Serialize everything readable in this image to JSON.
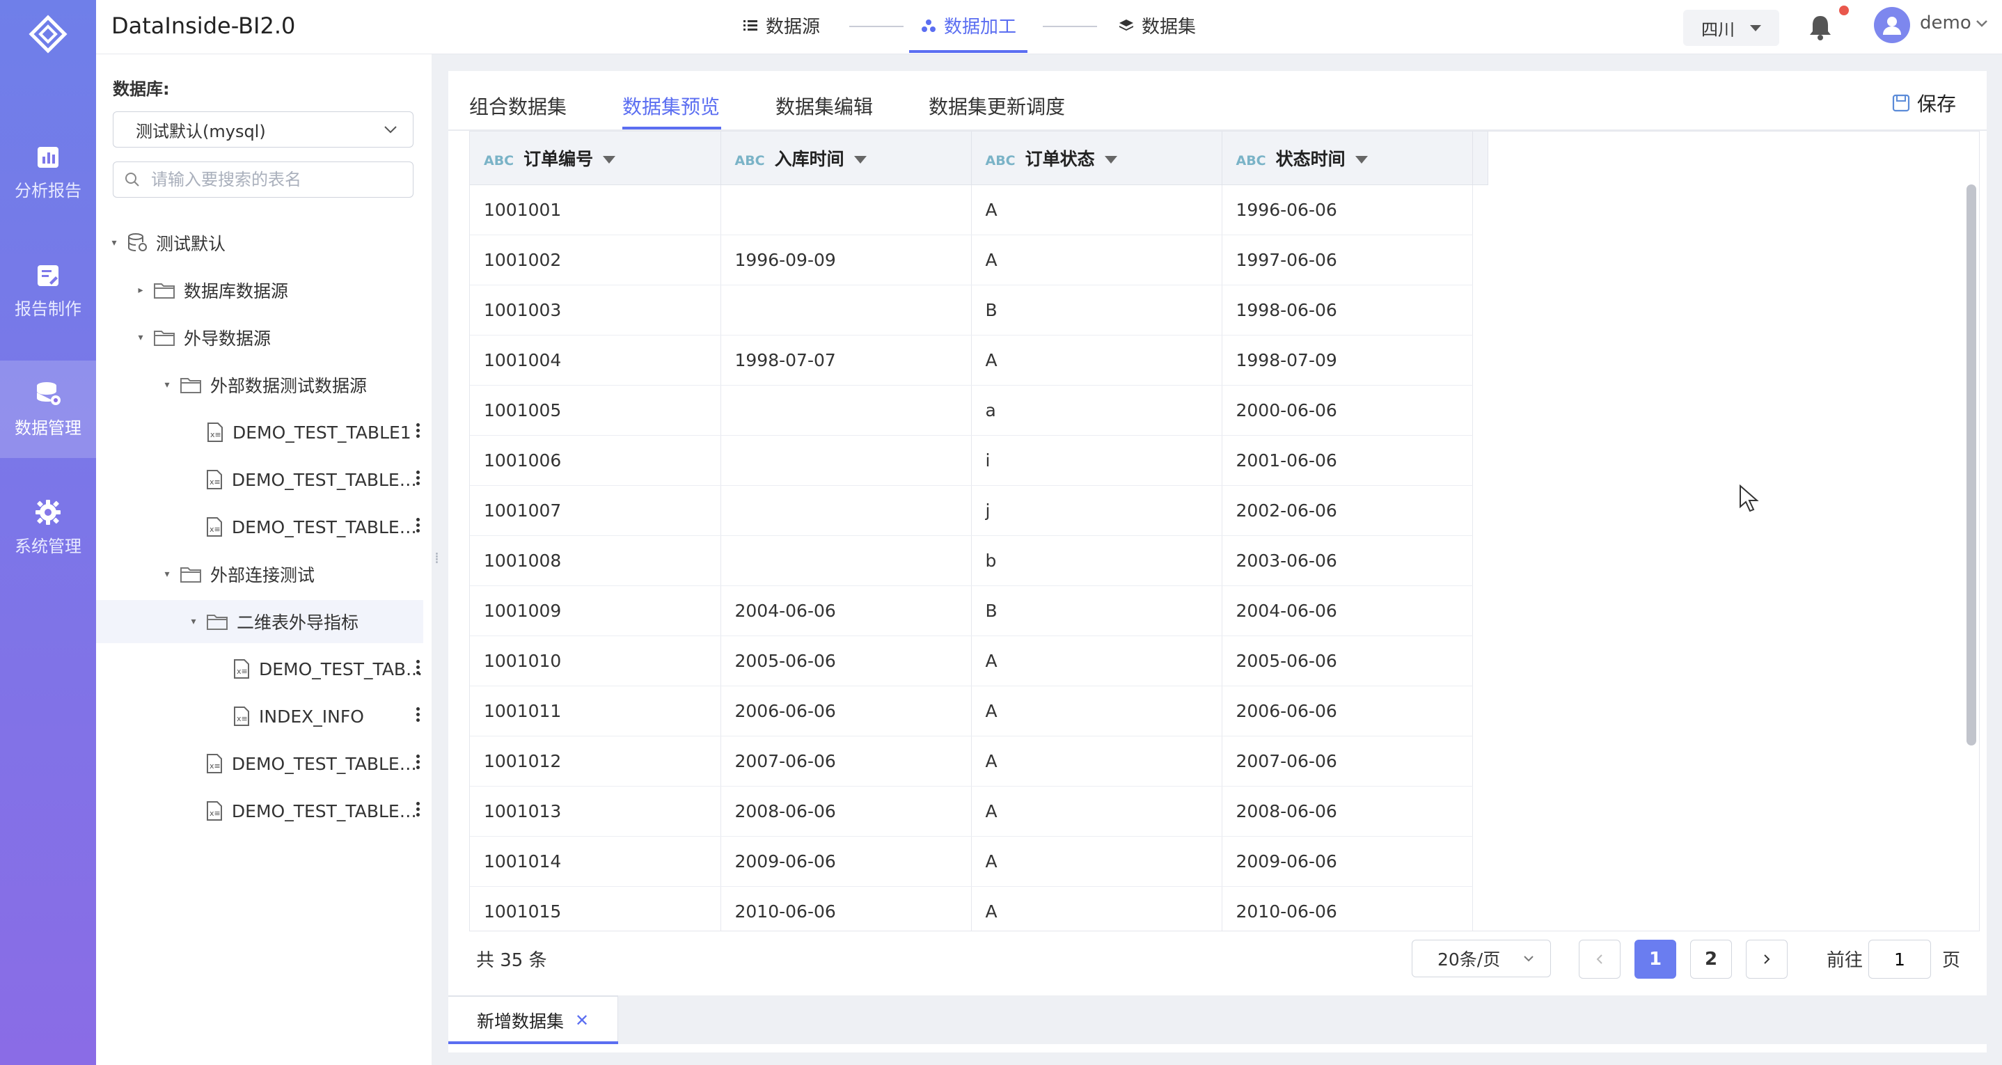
{
  "app": {
    "title": "DataInside-BI2.0"
  },
  "rail": {
    "items": [
      {
        "label": "分析报告",
        "icon": "report-chart-icon"
      },
      {
        "label": "报告制作",
        "icon": "edit-doc-icon"
      },
      {
        "label": "数据管理",
        "icon": "database-icon",
        "active": true
      },
      {
        "label": "系统管理",
        "icon": "gear-icon"
      }
    ]
  },
  "steps": [
    {
      "label": "数据源",
      "icon": "list-icon"
    },
    {
      "label": "数据加工",
      "icon": "cluster-icon",
      "active": true
    },
    {
      "label": "数据集",
      "icon": "layers-icon"
    }
  ],
  "header": {
    "region": "四川",
    "user": "demo"
  },
  "sidebar": {
    "db_label": "数据库:",
    "db_select": "测试默认(mysql)",
    "search_placeholder": "请输入要搜索的表名",
    "tree": [
      {
        "label": "测试默认",
        "type": "db",
        "level": 0,
        "expanded": true
      },
      {
        "label": "数据库数据源",
        "type": "folder",
        "level": 1,
        "expanded": false
      },
      {
        "label": "外导数据源",
        "type": "folder",
        "level": 1,
        "expanded": true
      },
      {
        "label": "外部数据测试数据源",
        "type": "folder",
        "level": 2,
        "expanded": true
      },
      {
        "label": "DEMO_TEST_TABLE1",
        "type": "table",
        "level": 3
      },
      {
        "label": "DEMO_TEST_TABLE_...",
        "type": "table",
        "level": 3
      },
      {
        "label": "DEMO_TEST_TABLE_...",
        "type": "table",
        "level": 3
      },
      {
        "label": "外部连接测试",
        "type": "folder",
        "level": 2,
        "expanded": true
      },
      {
        "label": "二维表外导指标",
        "type": "folder",
        "level": 3,
        "expanded": true,
        "active": true
      },
      {
        "label": "DEMO_TEST_TAB...",
        "type": "table",
        "level": 4
      },
      {
        "label": "INDEX_INFO",
        "type": "table",
        "level": 4
      },
      {
        "label": "DEMO_TEST_TABLE_...",
        "type": "table",
        "level": 3
      },
      {
        "label": "DEMO_TEST_TABLE_...",
        "type": "table",
        "level": 3
      }
    ]
  },
  "tabs": [
    {
      "label": "组合数据集"
    },
    {
      "label": "数据集预览",
      "active": true
    },
    {
      "label": "数据集编辑"
    },
    {
      "label": "数据集更新调度"
    }
  ],
  "save_label": "保存",
  "table": {
    "type_tag": "ABC",
    "columns": [
      "订单编号",
      "入库时间",
      "订单状态",
      "状态时间"
    ],
    "rows": [
      [
        "1001001",
        "",
        "A",
        "1996-06-06"
      ],
      [
        "1001002",
        "1996-09-09",
        "A",
        "1997-06-06"
      ],
      [
        "1001003",
        "",
        "B",
        "1998-06-06"
      ],
      [
        "1001004",
        "1998-07-07",
        "A",
        "1998-07-09"
      ],
      [
        "1001005",
        "",
        "a",
        "2000-06-06"
      ],
      [
        "1001006",
        "",
        "i",
        "2001-06-06"
      ],
      [
        "1001007",
        "",
        "j",
        "2002-06-06"
      ],
      [
        "1001008",
        "",
        "b",
        "2003-06-06"
      ],
      [
        "1001009",
        "2004-06-06",
        "B",
        "2004-06-06"
      ],
      [
        "1001010",
        "2005-06-06",
        "A",
        "2005-06-06"
      ],
      [
        "1001011",
        "2006-06-06",
        "A",
        "2006-06-06"
      ],
      [
        "1001012",
        "2007-06-06",
        "A",
        "2007-06-06"
      ],
      [
        "1001013",
        "2008-06-06",
        "A",
        "2008-06-06"
      ],
      [
        "1001014",
        "2009-06-06",
        "A",
        "2009-06-06"
      ],
      [
        "1001015",
        "2010-06-06",
        "A",
        "2010-06-06"
      ]
    ]
  },
  "pagination": {
    "total": "共 35 条",
    "page_size": "20条/页",
    "pages": [
      "1",
      "2"
    ],
    "current": "1",
    "goto_prefix": "前往",
    "goto_value": "1",
    "goto_suffix": "页"
  },
  "bottom_tab": {
    "label": "新增数据集"
  },
  "colors": {
    "accent": "#5b6ef1",
    "rail_top": "#6f7fe9",
    "rail_bottom": "#8a6ce6",
    "badge": "#e9574c"
  }
}
